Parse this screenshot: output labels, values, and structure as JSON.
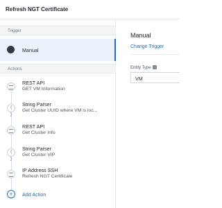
{
  "header": {
    "title": "Refresh NGT Certificate"
  },
  "sections": {
    "trigger": "Trigger",
    "actions": "Actions"
  },
  "trigger": {
    "label": "Manual",
    "icon": "hand-icon"
  },
  "actions": [
    {
      "type": "REST API",
      "name": "GET VM Information",
      "icon": "rest-api-icon"
    },
    {
      "type": "String Parser",
      "name": "Get Cluster UUID where VM is loc...",
      "icon": "braces-icon"
    },
    {
      "type": "REST API",
      "name": "Get Cluster Info",
      "icon": "rest-api-icon"
    },
    {
      "type": "String Parser",
      "name": "Get Cluster VIP",
      "icon": "braces-icon"
    },
    {
      "type": "IP Address SSH",
      "name": "Refresh NGT Certificate",
      "icon": "ssh-icon"
    }
  ],
  "add_action": {
    "label": "Add Action"
  },
  "panel": {
    "title": "Manual",
    "change_link": "Change Trigger",
    "entity_type_label": "Entity Type",
    "entity_type_value": "VM"
  },
  "colors": {
    "accent": "#1b6dc1",
    "selected_bg": "#eaf2fb"
  }
}
